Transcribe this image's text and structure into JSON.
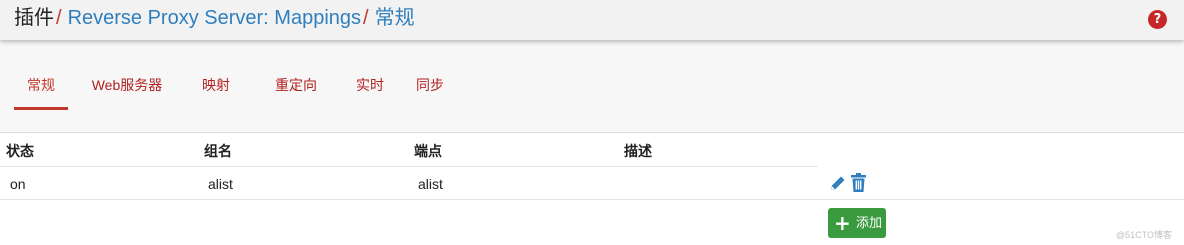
{
  "breadcrumb": {
    "root": "插件",
    "separator": "/",
    "section": "Reverse Proxy Server: Mappings",
    "current": "常规"
  },
  "help": {
    "icon": "help-icon",
    "glyph": "?"
  },
  "tabs": [
    {
      "label": "常规",
      "active": true
    },
    {
      "label": "Web服务器",
      "active": false
    },
    {
      "label": "映射",
      "active": false
    },
    {
      "label": "重定向",
      "active": false
    },
    {
      "label": "实时",
      "active": false
    },
    {
      "label": "同步",
      "active": false
    }
  ],
  "table": {
    "headers": [
      "状态",
      "组名",
      "端点",
      "描述"
    ],
    "rows": [
      {
        "status": "on",
        "group": "alist",
        "endpoint": "alist",
        "description": ""
      }
    ],
    "row_actions": [
      "pencil-icon",
      "trash-icon"
    ]
  },
  "add_button": {
    "icon": "plus-icon",
    "label": "添加"
  },
  "watermark": "@51CTO博客",
  "colors": {
    "link": "#2f7fbf",
    "accent_red": "#c0392b",
    "action_blue": "#2f7fbf",
    "button_green": "#3a9a3f",
    "help_red": "#c62828"
  }
}
